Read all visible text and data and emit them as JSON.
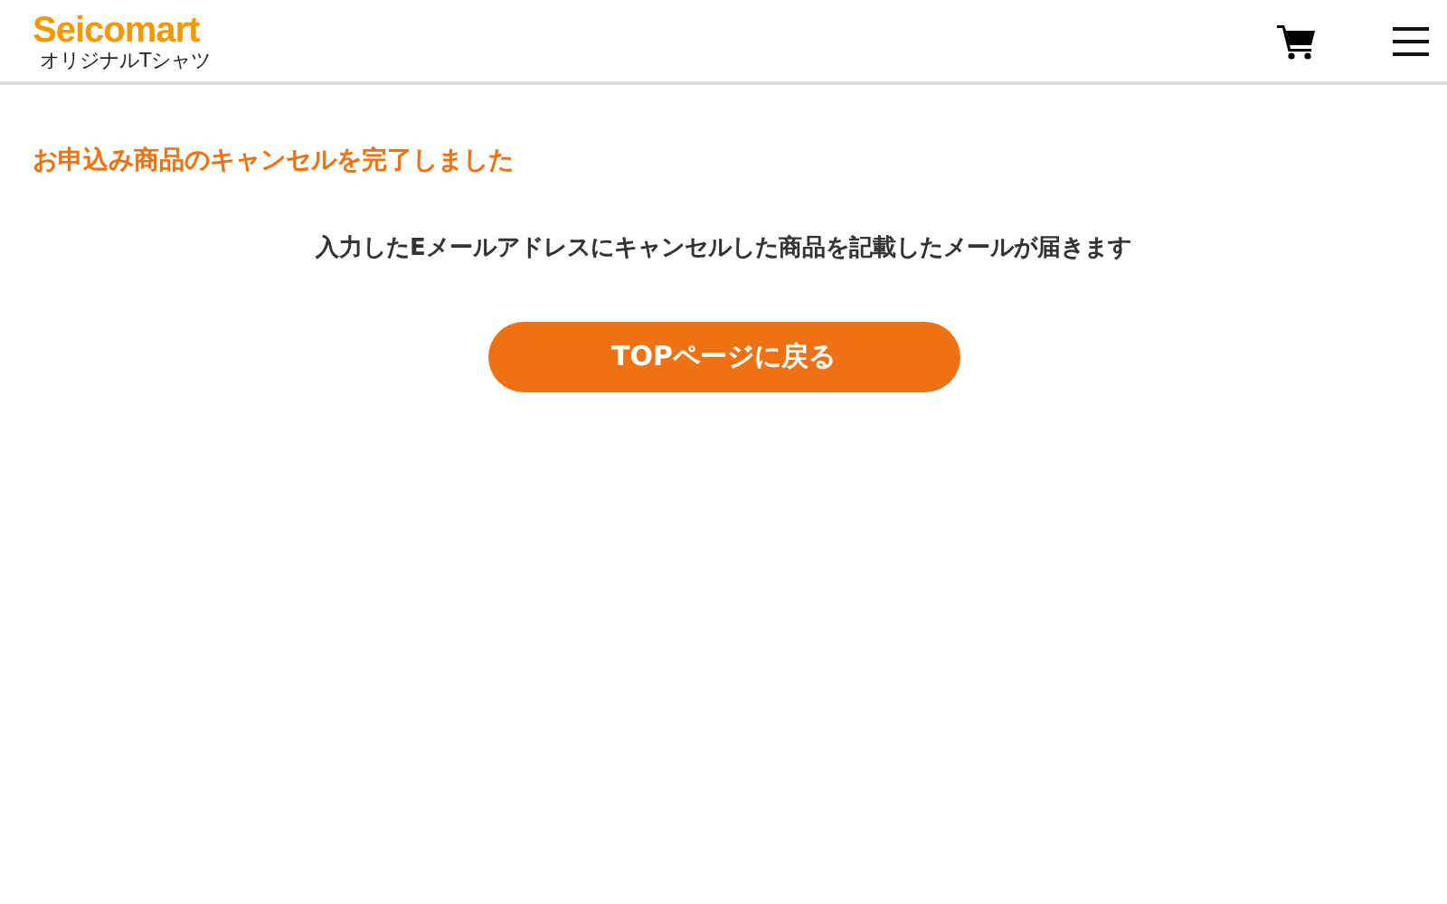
{
  "header": {
    "logo": "Seicomart",
    "subtitle": "オリジナルTシャツ"
  },
  "heading": "お申込み商品のキャンセルを完了しました",
  "message": "入力したEメールアドレスにキャンセルした商品を記載したメールが届きます",
  "button": "TOPページに戻る"
}
